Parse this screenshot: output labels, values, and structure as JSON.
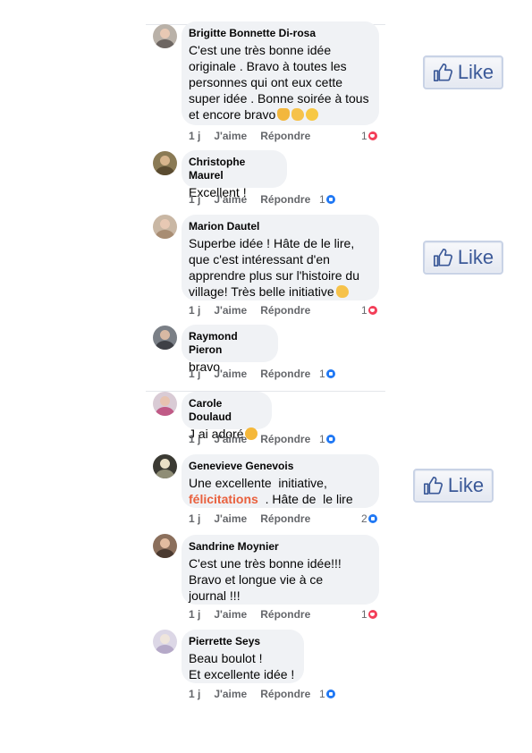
{
  "like_button": {
    "label": "Like"
  },
  "comments": [
    {
      "name": "Brigitte Bonnette Di-rosa",
      "text": "C'est une très bonne idée\noriginale . Bravo à toutes les\npersonnes qui ont eux cette\nsuper idée . Bonne soirée à tous\net encore bravo",
      "emojis": [
        "thumbs-up-emoji",
        "clapping-hands-emoji",
        "kissing-face-emoji"
      ],
      "time": "1 j",
      "like_label": "J'aime",
      "reply_label": "Répondre",
      "reaction_count": "1",
      "reaction": "heart"
    },
    {
      "name": "Christophe Maurel",
      "text": "Excellent !",
      "time": "1 j",
      "like_label": "J'aime",
      "reply_label": "Répondre",
      "reaction_count": "1",
      "reaction": "like"
    },
    {
      "name": "Marion Dautel",
      "text": "Superbe idée ! Hâte de le lire,\nque c'est intéressant d'en\napprendre plus sur l'histoire du\nvillage! Très belle initiative",
      "emojis": [
        "clapping-hands-emoji"
      ],
      "time": "1 j",
      "like_label": "J'aime",
      "reply_label": "Répondre",
      "reaction_count": "1",
      "reaction": "heart"
    },
    {
      "name": "Raymond Pieron",
      "text": "bravo",
      "time": "1 j",
      "like_label": "J'aime",
      "reply_label": "Répondre",
      "reaction_count": "1",
      "reaction": "like"
    },
    {
      "name": "Carole Doulaud",
      "text": "J ai adoré",
      "emojis": [
        "smiling-face-with-hearts-emoji"
      ],
      "time": "1 j",
      "like_label": "J'aime",
      "reply_label": "Répondre",
      "reaction_count": "1",
      "reaction": "like"
    },
    {
      "name": "Genevieve Genevois",
      "text_before": "Une excellente  initiative,",
      "text_highlight": "félicitations",
      "text_after": "  . Hâte de  le lire",
      "time": "1 j",
      "like_label": "J'aime",
      "reply_label": "Répondre",
      "reaction_count": "2",
      "reaction": "like"
    },
    {
      "name": "Sandrine Moynier",
      "text": "C'est une très bonne idée!!!\nBravo et longue vie à ce\njournal !!!",
      "time": "1 j",
      "like_label": "J'aime",
      "reply_label": "Répondre",
      "reaction_count": "1",
      "reaction": "heart"
    },
    {
      "name": "Pierrette Seys",
      "text": "Beau boulot !\nEt excellente idée !",
      "time": "1 j",
      "like_label": "J'aime",
      "reply_label": "Répondre",
      "reaction_count": "1",
      "reaction": "like"
    }
  ],
  "colors": {
    "bubble": "#f0f2f5",
    "meta_text": "#65676b",
    "highlight": "#e9603d",
    "heart_reaction": "#f33e58",
    "like_reaction": "#2078f4",
    "like_button_text": "#3b5998"
  }
}
